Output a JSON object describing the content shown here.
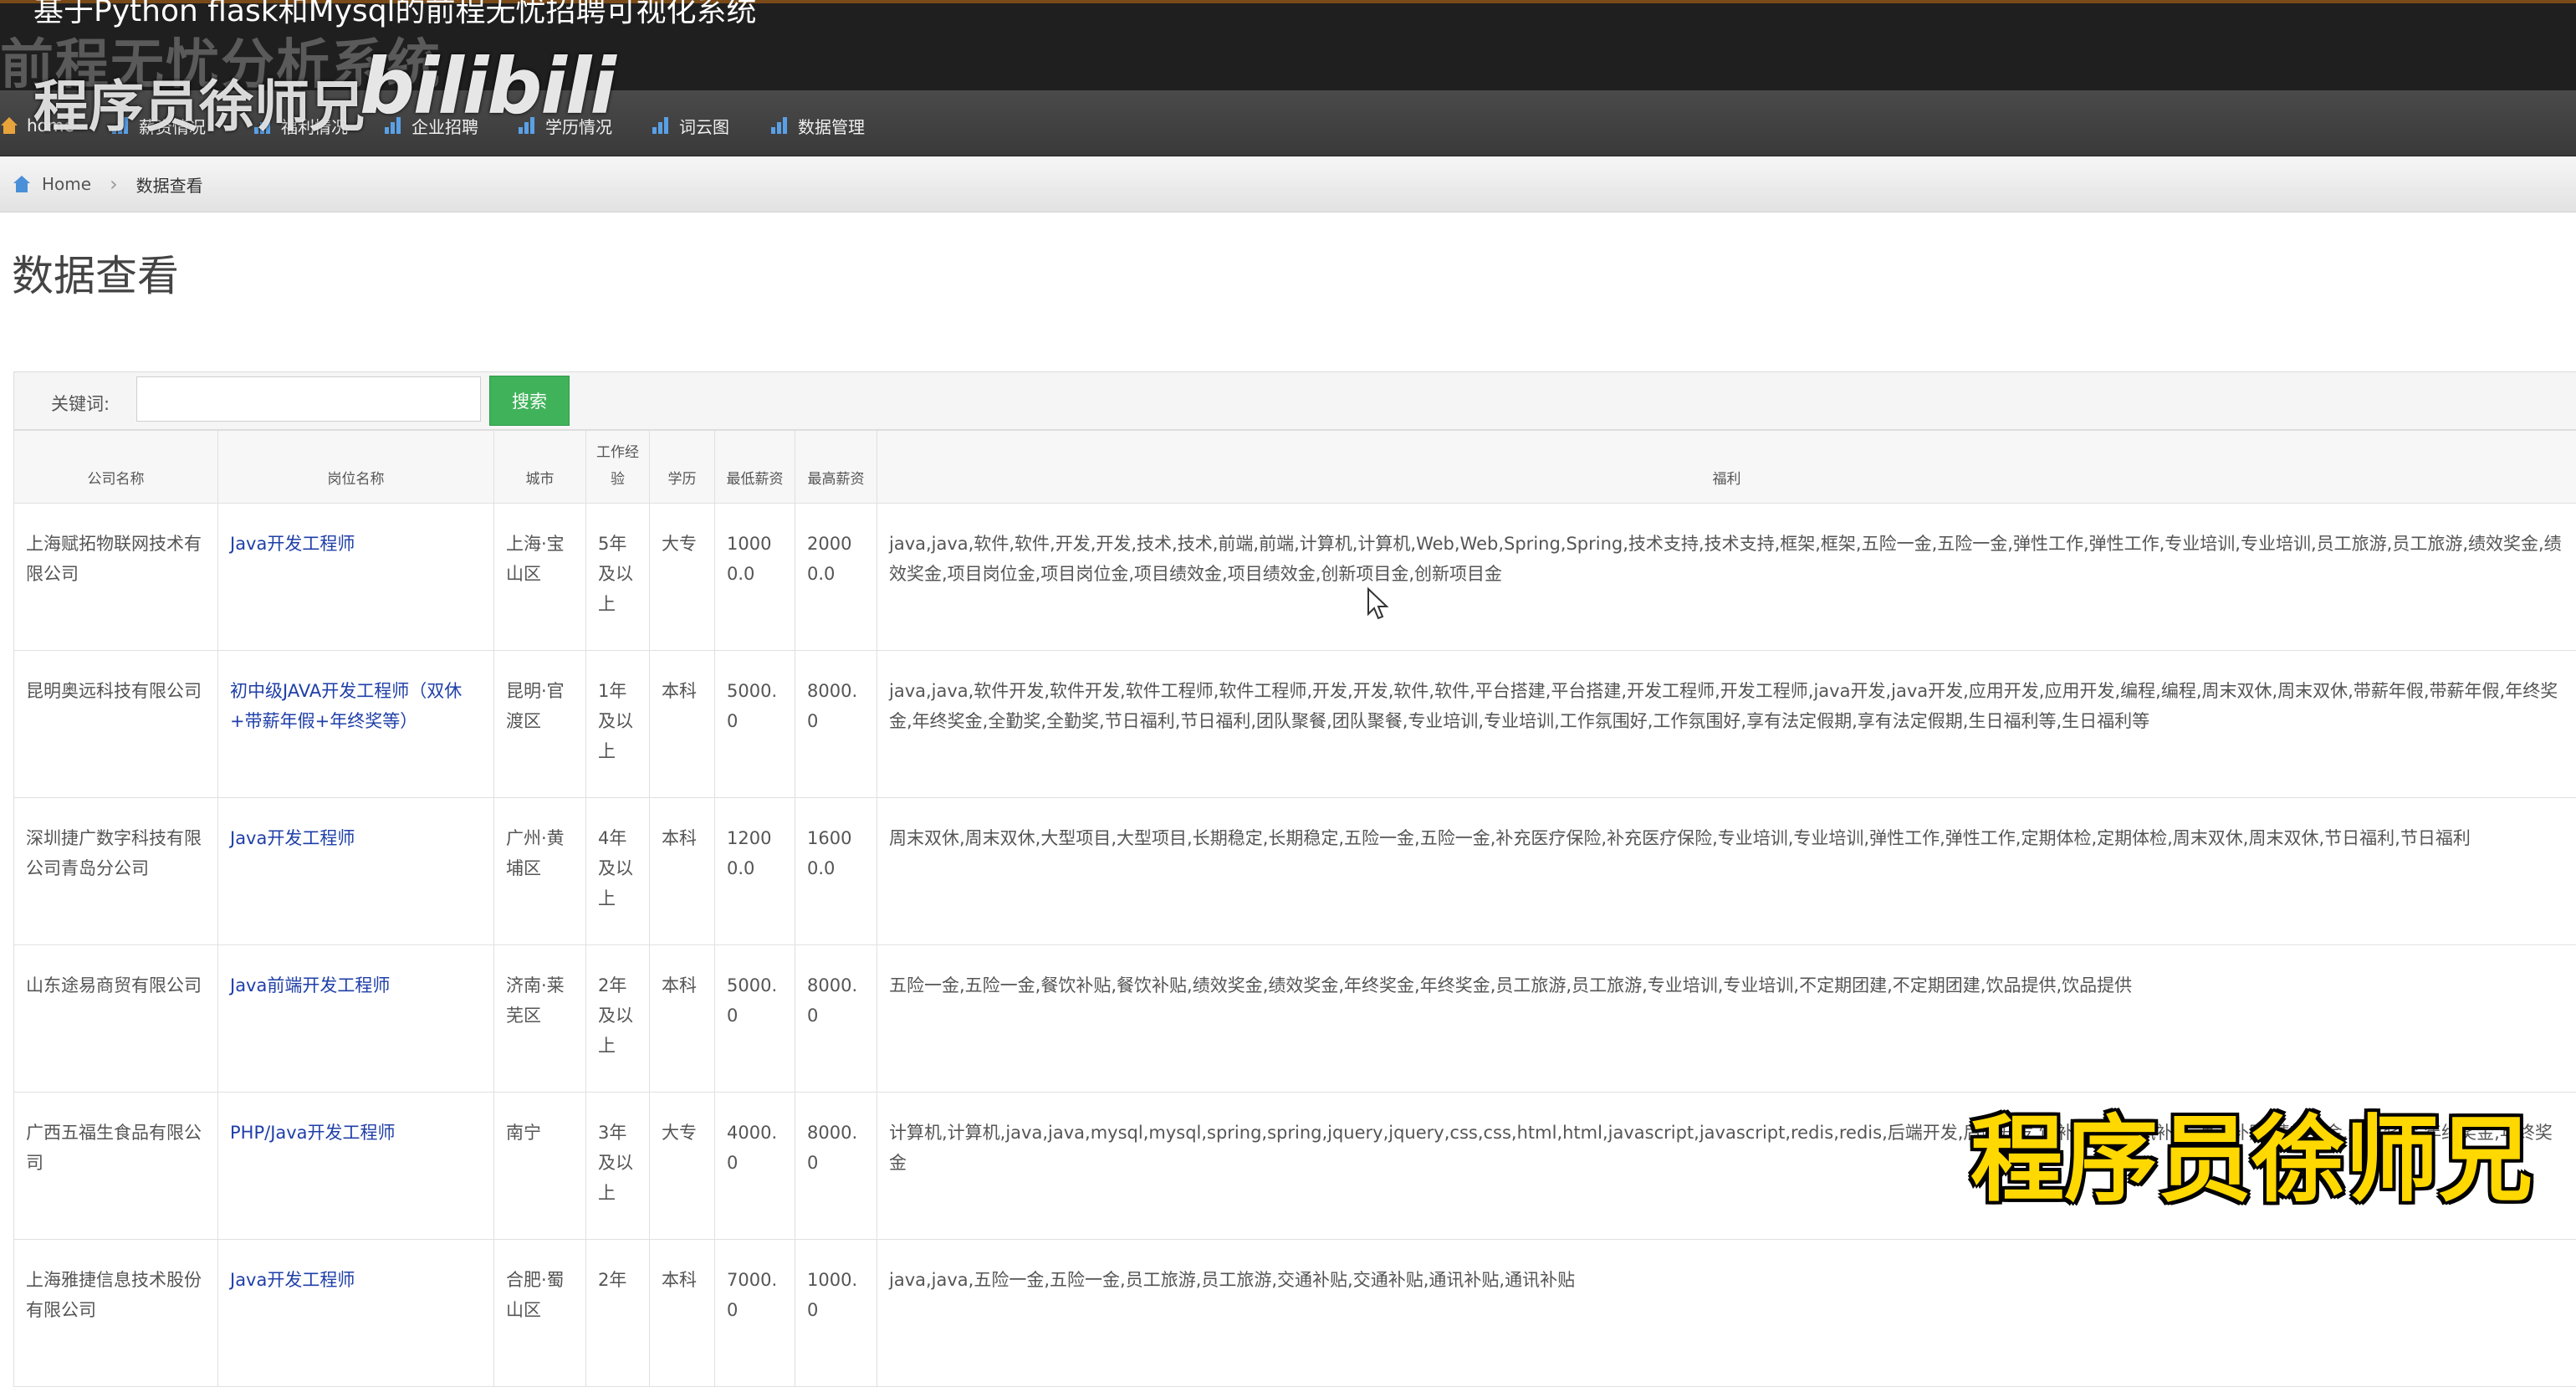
{
  "window": {
    "title": "基于Python flask和Mysql的前程无忧招聘可视化系统",
    "brand_ghost": "前程无忧分析系统"
  },
  "watermark": {
    "uploader": "程序员徐师兄",
    "logo_text": "bilibili"
  },
  "nav": {
    "items": [
      {
        "label": "home",
        "icon": "home-icon"
      },
      {
        "label": "薪资情况",
        "icon": "bar-chart-icon"
      },
      {
        "label": "福利情况",
        "icon": "bar-chart-icon"
      },
      {
        "label": "企业招聘",
        "icon": "bar-chart-icon"
      },
      {
        "label": "学历情况",
        "icon": "bar-chart-icon"
      },
      {
        "label": "词云图",
        "icon": "bar-chart-icon"
      },
      {
        "label": "数据管理",
        "icon": "bar-chart-icon"
      }
    ]
  },
  "breadcrumb": {
    "home": "Home",
    "current": "数据查看"
  },
  "page": {
    "title": "数据查看"
  },
  "search": {
    "label": "关键词:",
    "value": "",
    "button": "搜索"
  },
  "table": {
    "headers": [
      "公司名称",
      "岗位名称",
      "城市",
      "工作经验",
      "学历",
      "最低薪资",
      "最高薪资",
      "福利"
    ],
    "rows": [
      {
        "company": "上海赋拓物联网技术有限公司",
        "job": "Java开发工程师",
        "city": "上海·宝山区",
        "experience": "5年及以上",
        "education": "大专",
        "min_salary": "10000.0",
        "max_salary": "20000.0",
        "welfare": "java,java,软件,软件,开发,开发,技术,技术,前端,前端,计算机,计算机,Web,Web,Spring,Spring,技术支持,技术支持,框架,框架,五险一金,五险一金,弹性工作,弹性工作,专业培训,专业培训,员工旅游,员工旅游,绩效奖金,绩效奖金,项目岗位金,项目岗位金,项目绩效金,项目绩效金,创新项目金,创新项目金"
      },
      {
        "company": "昆明奥远科技有限公司",
        "job": "初中级JAVA开发工程师（双休+带薪年假+年终奖等）",
        "city": "昆明·官渡区",
        "experience": "1年及以上",
        "education": "本科",
        "min_salary": "5000.0",
        "max_salary": "8000.0",
        "welfare": "java,java,软件开发,软件开发,软件工程师,软件工程师,开发,开发,软件,软件,平台搭建,平台搭建,开发工程师,开发工程师,java开发,java开发,应用开发,应用开发,编程,编程,周末双休,周末双休,带薪年假,带薪年假,年终奖金,年终奖金,全勤奖,全勤奖,节日福利,节日福利,团队聚餐,团队聚餐,专业培训,专业培训,工作氛围好,工作氛围好,享有法定假期,享有法定假期,生日福利等,生日福利等"
      },
      {
        "company": "深圳捷广数字科技有限公司青岛分公司",
        "job": "Java开发工程师",
        "city": "广州·黄埔区",
        "experience": "4年及以上",
        "education": "本科",
        "min_salary": "12000.0",
        "max_salary": "16000.0",
        "welfare": "周末双休,周末双休,大型项目,大型项目,长期稳定,长期稳定,五险一金,五险一金,补充医疗保险,补充医疗保险,专业培训,专业培训,弹性工作,弹性工作,定期体检,定期体检,周末双休,周末双休,节日福利,节日福利"
      },
      {
        "company": "山东途易商贸有限公司",
        "job": "Java前端开发工程师",
        "city": "济南·莱芜区",
        "experience": "2年及以上",
        "education": "本科",
        "min_salary": "5000.0",
        "max_salary": "8000.0",
        "welfare": "五险一金,五险一金,餐饮补贴,餐饮补贴,绩效奖金,绩效奖金,年终奖金,年终奖金,员工旅游,员工旅游,专业培训,专业培训,不定期团建,不定期团建,饮品提供,饮品提供"
      },
      {
        "company": "广西五福生食品有限公司",
        "job": "PHP/Java开发工程师",
        "city": "南宁",
        "experience": "3年及以上",
        "education": "大专",
        "min_salary": "4000.0",
        "max_salary": "8000.0",
        "welfare": "计算机,计算机,java,java,mysql,mysql,spring,spring,jquery,jquery,css,css,html,html,javascript,javascript,redis,redis,后端开发,后端开发,饭补,饭补,通讯补贴,通讯补贴,绩效奖金,绩效奖金,年终奖金,年终奖金"
      },
      {
        "company": "上海雅捷信息技术股份有限公司",
        "job": "Java开发工程师",
        "city": "合肥·蜀山区",
        "experience": "2年",
        "education": "本科",
        "min_salary": "7000.0",
        "max_salary": "1000.0",
        "welfare": "java,java,五险一金,五险一金,员工旅游,员工旅游,交通补贴,交通补贴,通讯补贴,通讯补贴"
      }
    ]
  },
  "overlay_caption": "程序员徐师兄"
}
